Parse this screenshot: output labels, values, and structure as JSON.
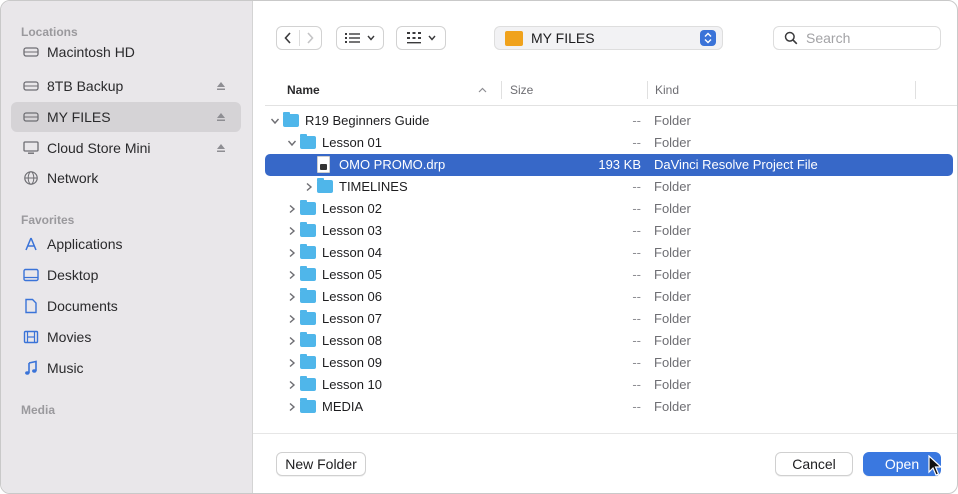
{
  "sidebar": {
    "locations_label": "Locations",
    "favorites_label": "Favorites",
    "media_label": "Media",
    "locations": [
      {
        "label": "Macintosh HD",
        "icon": "drive-icon",
        "eject": false
      },
      {
        "label": "8TB Backup",
        "icon": "drive-icon",
        "eject": true
      },
      {
        "label": "MY FILES",
        "icon": "drive-icon",
        "eject": true,
        "selected": true
      },
      {
        "label": "Cloud Store Mini",
        "icon": "display-icon",
        "eject": true
      },
      {
        "label": "Network",
        "icon": "globe-icon",
        "eject": false
      }
    ],
    "favorites": [
      {
        "label": "Applications",
        "icon": "applications-icon"
      },
      {
        "label": "Desktop",
        "icon": "desktop-icon"
      },
      {
        "label": "Documents",
        "icon": "document-icon"
      },
      {
        "label": "Movies",
        "icon": "film-icon"
      },
      {
        "label": "Music",
        "icon": "music-note-icon"
      }
    ]
  },
  "toolbar": {
    "location": "MY FILES",
    "search_placeholder": "Search"
  },
  "columns": {
    "name": "Name",
    "size": "Size",
    "kind": "Kind"
  },
  "rows": [
    {
      "name": "R19 Beginners Guide",
      "size": "--",
      "kind": "Folder",
      "type": "folder",
      "expanded": true,
      "indent": 0
    },
    {
      "name": "Lesson 01",
      "size": "--",
      "kind": "Folder",
      "type": "folder",
      "expanded": true,
      "indent": 1
    },
    {
      "name": "OMO PROMO.drp",
      "size": "193 KB",
      "kind": "DaVinci Resolve Project File",
      "type": "file",
      "indent": 2,
      "selected": true
    },
    {
      "name": "TIMELINES",
      "size": "--",
      "kind": "Folder",
      "type": "folder",
      "expanded": false,
      "indent": 2
    },
    {
      "name": "Lesson 02",
      "size": "--",
      "kind": "Folder",
      "type": "folder",
      "expanded": false,
      "indent": 1
    },
    {
      "name": "Lesson 03",
      "size": "--",
      "kind": "Folder",
      "type": "folder",
      "expanded": false,
      "indent": 1
    },
    {
      "name": "Lesson 04",
      "size": "--",
      "kind": "Folder",
      "type": "folder",
      "expanded": false,
      "indent": 1
    },
    {
      "name": "Lesson 05",
      "size": "--",
      "kind": "Folder",
      "type": "folder",
      "expanded": false,
      "indent": 1
    },
    {
      "name": "Lesson 06",
      "size": "--",
      "kind": "Folder",
      "type": "folder",
      "expanded": false,
      "indent": 1
    },
    {
      "name": "Lesson 07",
      "size": "--",
      "kind": "Folder",
      "type": "folder",
      "expanded": false,
      "indent": 1
    },
    {
      "name": "Lesson 08",
      "size": "--",
      "kind": "Folder",
      "type": "folder",
      "expanded": false,
      "indent": 1
    },
    {
      "name": "Lesson 09",
      "size": "--",
      "kind": "Folder",
      "type": "folder",
      "expanded": false,
      "indent": 1
    },
    {
      "name": "Lesson 10",
      "size": "--",
      "kind": "Folder",
      "type": "folder",
      "expanded": false,
      "indent": 1
    },
    {
      "name": "MEDIA",
      "size": "--",
      "kind": "Folder",
      "type": "folder",
      "expanded": false,
      "indent": 1
    }
  ],
  "buttons": {
    "new_folder": "New Folder",
    "cancel": "Cancel",
    "open": "Open"
  },
  "colors": {
    "selection": "#3768c8",
    "folder": "#4fb6ea",
    "primary_button": "#3a78e0",
    "drive_folder": "#f0a21c"
  }
}
